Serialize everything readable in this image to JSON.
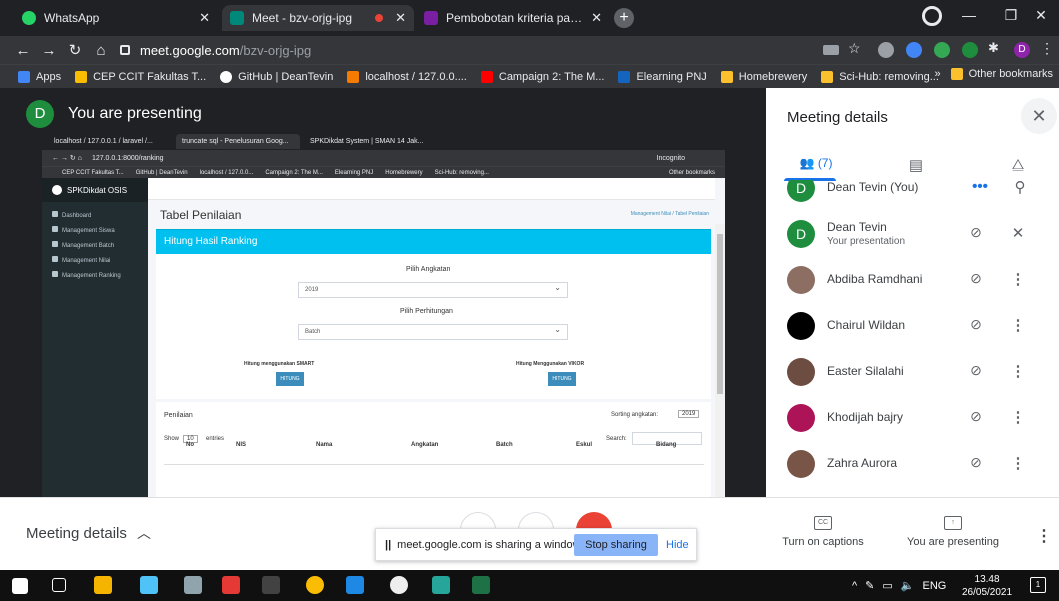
{
  "browser": {
    "tabs": [
      {
        "title": "WhatsApp",
        "color": "#25d366"
      },
      {
        "title": "Meet - bzv-orjg-ipg",
        "color": "#00897b"
      },
      {
        "title": "Pembobotan kriteria pada DIKLA",
        "color": "#7b1fa2"
      }
    ],
    "url_host": "meet.google.com",
    "url_path": "/bzv-orjg-ipg",
    "profile_initial": "D",
    "bookmarks": [
      "Apps",
      "CEP CCIT Fakultas T...",
      "GitHub | DeanTevin",
      "localhost / 127.0.0....",
      "Campaign 2: The M...",
      "Elearning PNJ",
      "Homebrewery",
      "Sci-Hub: removing..."
    ],
    "bookmarks_overflow": "»",
    "other_bookmarks": "Other bookmarks"
  },
  "meet": {
    "presenter_initial": "D",
    "presenting_title": "You are presenting",
    "panel_title": "Meeting details",
    "people_count": "(7)",
    "participants": [
      {
        "name": "Dean Tevin (You)",
        "sub": "",
        "initial": "D",
        "color": "#1e8e3e",
        "action": "•••"
      },
      {
        "name": "Dean Tevin",
        "sub": "Your presentation",
        "initial": "D",
        "color": "#1e8e3e",
        "action": ""
      },
      {
        "name": "Abdiba Ramdhani",
        "sub": "",
        "initial": "",
        "color": "#8d6e63",
        "action": "⋮"
      },
      {
        "name": "Chairul Wildan",
        "sub": "",
        "initial": "",
        "color": "#000000",
        "action": "⋮"
      },
      {
        "name": "Easter Silalahi",
        "sub": "",
        "initial": "",
        "color": "#6d4c41",
        "action": "⋮"
      },
      {
        "name": "Khodijah bajry",
        "sub": "",
        "initial": "",
        "color": "#ad1457",
        "action": "⋮"
      },
      {
        "name": "Zahra Aurora",
        "sub": "",
        "initial": "",
        "color": "#795548",
        "action": "⋮"
      }
    ],
    "bottom": {
      "details_label": "Meeting details",
      "captions_label": "Turn on captions",
      "captions_icon_text": "CC",
      "presenting_label": "You are presenting"
    },
    "share_toast": {
      "pause": "||",
      "message": "meet.google.com is sharing a window.",
      "stop": "Stop sharing",
      "hide": "Hide"
    }
  },
  "shared": {
    "tabs": [
      "localhost / 127.0.0.1 / laravel /...",
      "truncate sql - Penelusuran Goog...",
      "SPKDikdat System | SMAN 14 Jak..."
    ],
    "url": "127.0.0.1:8000/ranking",
    "incognito": "Incognito",
    "bookmarks": [
      "CEP CCIT Fakultas T...",
      "GitHub | DeanTevin",
      "localhost / 127.0.0...",
      "Campaign 2: The M...",
      "Elearning PNJ",
      "Homebrewery",
      "Sci-Hub: removing...",
      "Other bookmarks"
    ],
    "brand": "SPKDikdat OSIS",
    "menu": [
      "Dashboard",
      "Management Siswa",
      "Management Batch",
      "Management Nilai",
      "Management Ranking"
    ],
    "page_title": "Tabel Penilaian",
    "breadcrumb": "Management Nilai / Tabel Penilaian",
    "box_title": "Hitung Hasil Ranking",
    "angkatan_label": "Pilih Angkatan",
    "angkatan_value": "2019",
    "perhitungan_label": "Pilih Perhitungan",
    "perhitungan_value": "Batch",
    "smart_label": "Hitung menggunakan SMART",
    "vikor_label": "Hitung Menggunakan VIKOR",
    "hitung_btn": "HITUNG",
    "table_title": "Penilaian",
    "sorting_label": "Sorting angkatan:",
    "sorting_value": "2019",
    "show_label": "Show",
    "show_value": "10",
    "entries_label": "entries",
    "search_label": "Search:",
    "columns": [
      "No",
      "NIS",
      "Nama",
      "Angkatan",
      "Batch",
      "Eskul",
      "Bidang"
    ]
  },
  "taskbar": {
    "lang": "ENG",
    "time": "13.48",
    "date": "26/05/2021",
    "notif_count": "1"
  }
}
